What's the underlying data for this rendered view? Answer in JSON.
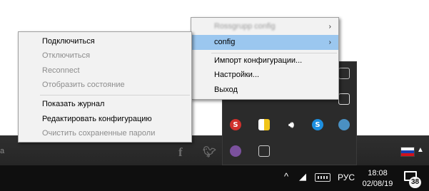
{
  "connection_menu": {
    "items": [
      {
        "label": "Подключиться",
        "enabled": true
      },
      {
        "label": "Отключиться",
        "enabled": false
      },
      {
        "label": "Reconnect",
        "enabled": false
      },
      {
        "label": "Отобразить состояние",
        "enabled": false
      },
      {
        "label": "Показать журнал",
        "enabled": true
      },
      {
        "label": "Редактировать конфигурацию",
        "enabled": true
      },
      {
        "label": "Очистить сохраненные пароли",
        "enabled": false
      }
    ]
  },
  "main_menu": {
    "blurred_label": "Rossgrupp config",
    "config_label": "config",
    "items": [
      {
        "label": "Импорт конфигурации..."
      },
      {
        "label": "Настройки..."
      },
      {
        "label": "Выход"
      }
    ],
    "highlight_color": "#9bc7ef"
  },
  "background": {
    "strip_text": "а"
  },
  "tray_icons": [
    "monitor-icon",
    "app-icon",
    "red-app-icon",
    "orange-app-icon",
    "orange-square-icon",
    "monitor2-icon",
    "skype-s-icon",
    "shield-icon",
    "volume-icon",
    "skype-icon",
    "globe-icon",
    "viber-icon",
    "display-icon"
  ],
  "taskbar": {
    "chevron": "^",
    "language": "РУС",
    "time": "18:08",
    "date": "02/08/19",
    "notification_count": "38"
  }
}
